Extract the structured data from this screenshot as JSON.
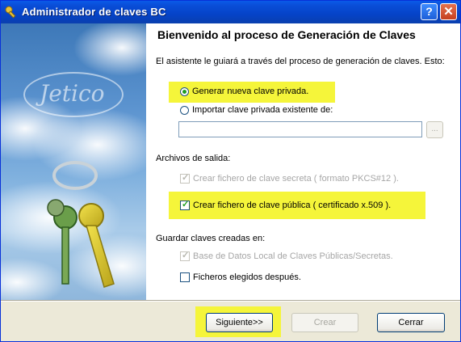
{
  "window": {
    "title": "Administrador de claves BC",
    "help_glyph": "?",
    "close_glyph": "✕",
    "icons": {
      "app": "key-app-icon",
      "help": "help-icon",
      "close": "close-icon"
    }
  },
  "brand": {
    "logo_text": "Jetico"
  },
  "wizard": {
    "heading": "Bienvenido al proceso de Generación de Claves",
    "intro": "El asistente le guiará a través del proceso de generación de claves. Esto:",
    "options": {
      "generate_label": "Generar nueva clave privada.",
      "generate_selected": true,
      "import_label": "Importar clave privada existente de:",
      "import_selected": false,
      "import_path_value": "",
      "browse_label": "..."
    },
    "output": {
      "label": "Archivos de salida:",
      "secret_label": "Crear fichero de clave secreta ( formato PKCS#12 ).",
      "secret_checked": true,
      "secret_enabled": false,
      "public_label": "Crear fichero de clave pública ( certificado x.509 ).",
      "public_checked": true
    },
    "save": {
      "label": "Guardar claves creadas en:",
      "local_db_label": "Base de Datos Local de Claves Públicas/Secretas.",
      "local_db_checked": true,
      "local_db_enabled": false,
      "files_later_label": "Ficheros elegidos después.",
      "files_later_checked": false
    }
  },
  "buttons": {
    "next": "Siguiente>>",
    "create": "Crear",
    "close": "Cerrar"
  },
  "colors": {
    "highlight": "#f5f53a",
    "titlebar": "#0a4ed8",
    "check": "#21a121"
  }
}
